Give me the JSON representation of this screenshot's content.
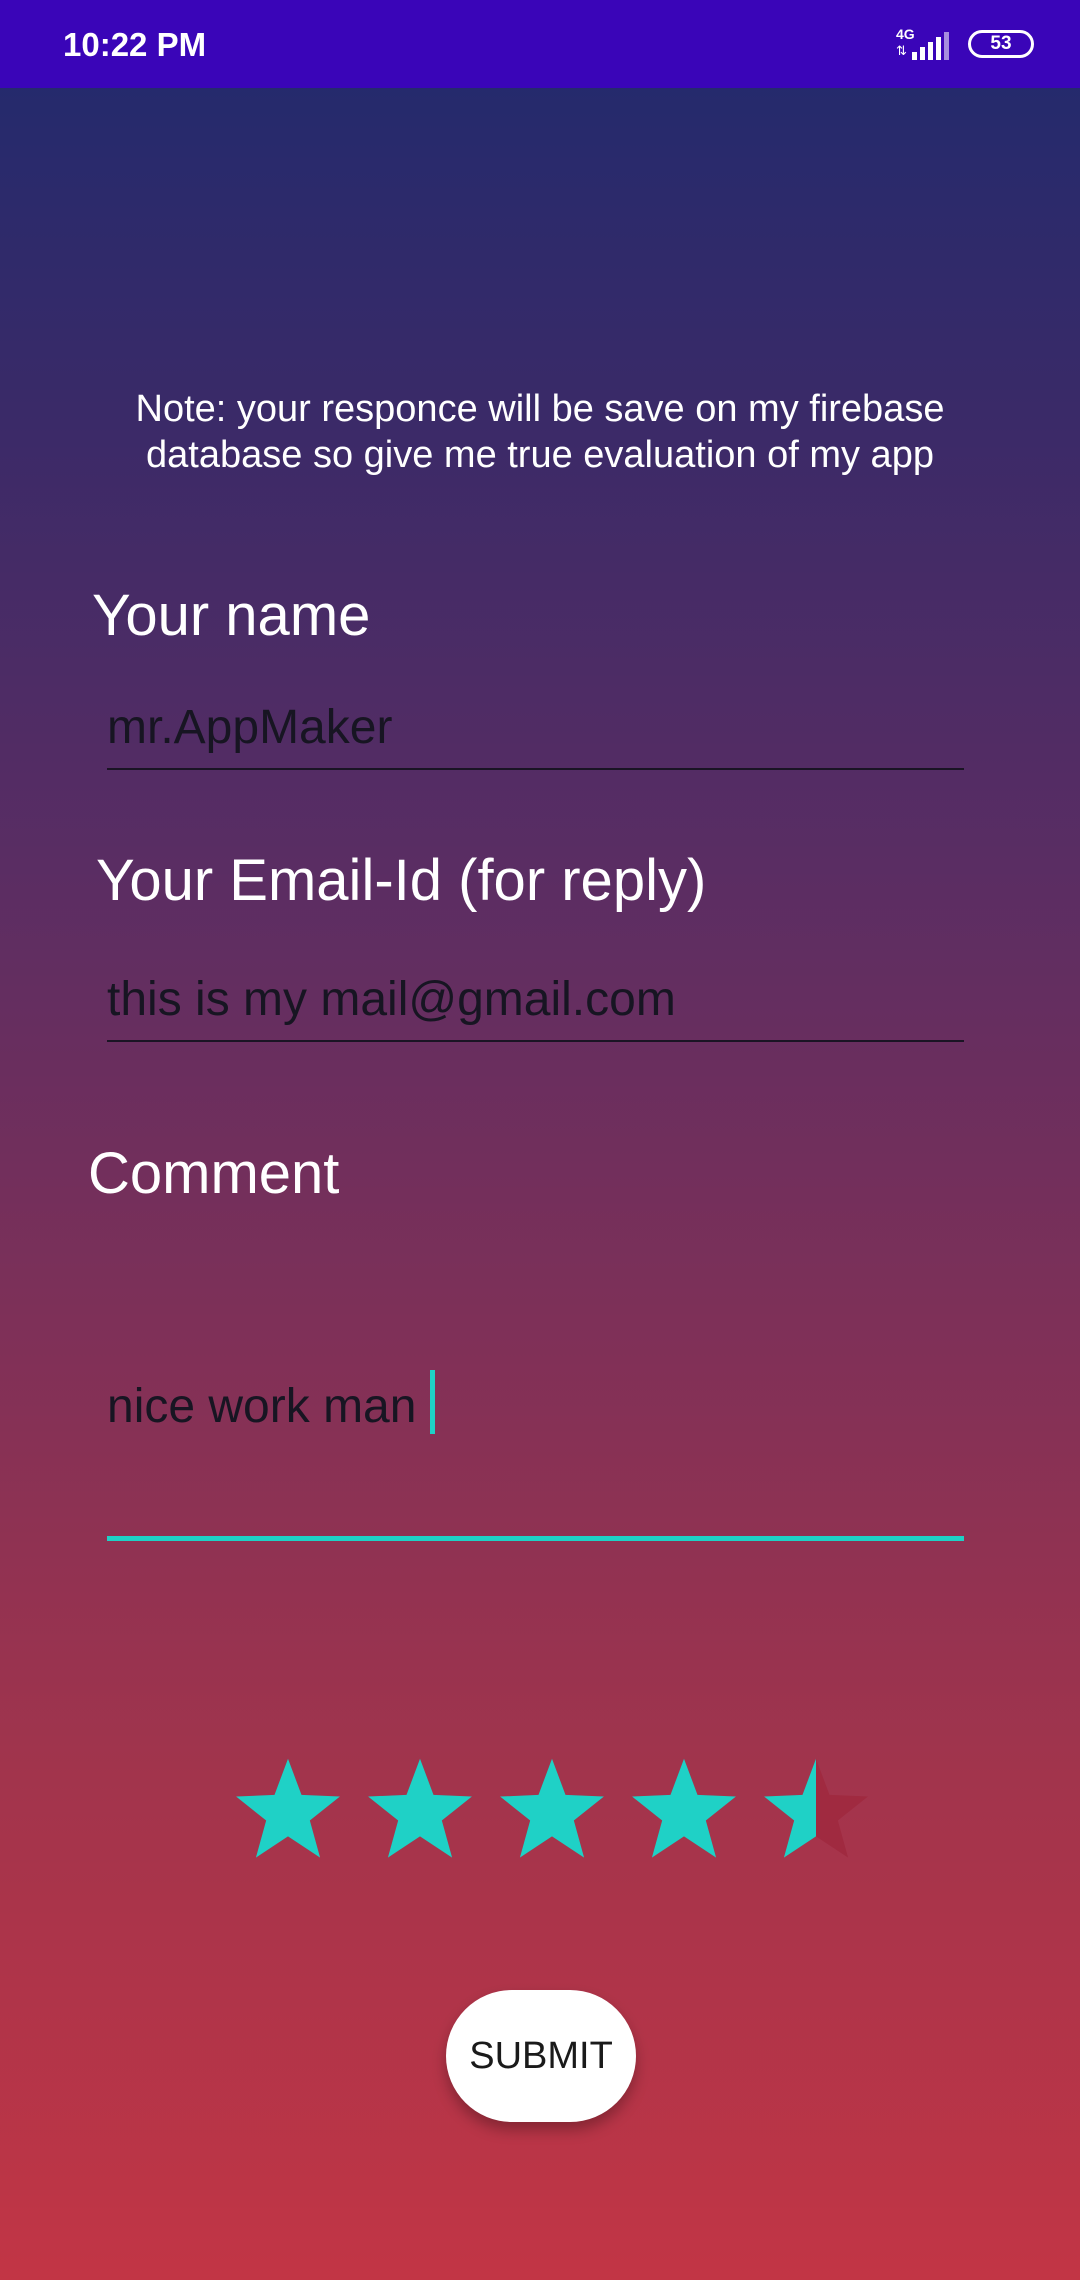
{
  "status_bar": {
    "time": "10:22 PM",
    "network_type": "4G",
    "battery_level": "53",
    "signal_icon": "signal-bars-icon",
    "battery_icon": "battery-icon"
  },
  "note": "Note: your responce will be save on my firebase database so give me true evaluation of my app",
  "form": {
    "name_label": "Your name",
    "name_value": "mr.AppMaker",
    "email_label": "Your Email-Id (for reply)",
    "email_value": "this is my mail@gmail.com",
    "comment_label": "Comment",
    "comment_value": "nice work man"
  },
  "rating": {
    "value": 4.5,
    "max": 5,
    "filled_color": "#1fd1c6",
    "empty_color": "#a02a40"
  },
  "submit_label": "SUBMIT",
  "colors": {
    "status_bar": "#3a05b8",
    "accent": "#1fd1c6",
    "gradient_top": "#1f2a6e",
    "gradient_bottom": "#c23545"
  }
}
